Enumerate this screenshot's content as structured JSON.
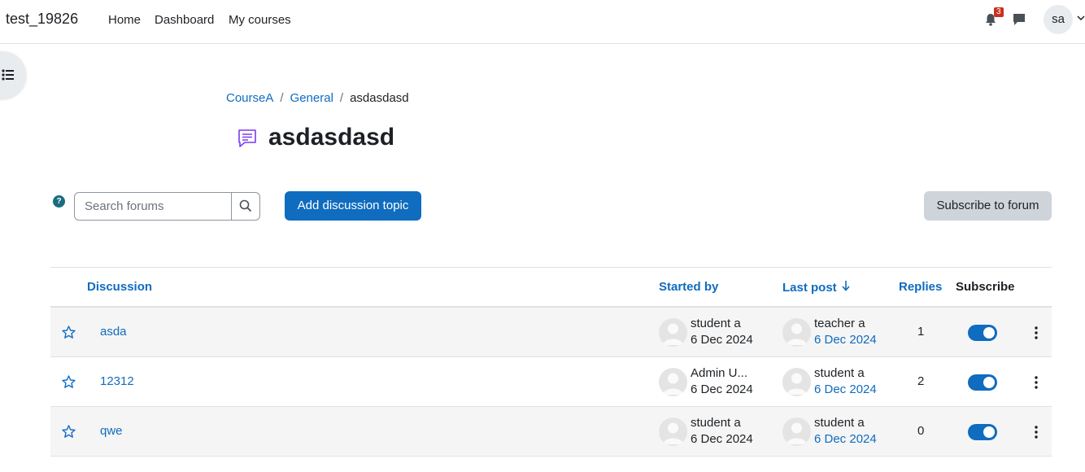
{
  "navbar": {
    "brand": "test_19826",
    "links": [
      "Home",
      "Dashboard",
      "My courses"
    ],
    "notification_count": "3",
    "user_initials": "sa"
  },
  "breadcrumb": [
    "CourseA",
    "General",
    "asdasdasd"
  ],
  "page": {
    "title": "asdasdasd"
  },
  "toolbar": {
    "help": "?",
    "search_placeholder": "Search forums",
    "search_value": "",
    "add_label": "Add discussion topic",
    "subscribe_label": "Subscribe to forum"
  },
  "table": {
    "headers": {
      "discussion": "Discussion",
      "started_by": "Started by",
      "last_post": "Last post",
      "replies": "Replies",
      "subscribe": "Subscribe"
    },
    "rows": [
      {
        "title": "asda",
        "started_by": "student a",
        "started_date": "6 Dec 2024",
        "last_post_by": "teacher a",
        "last_post_date": "6 Dec 2024",
        "replies": "1",
        "subscribed": true
      },
      {
        "title": "12312",
        "started_by": "Admin U...",
        "started_date": "6 Dec 2024",
        "last_post_by": "student a",
        "last_post_date": "6 Dec 2024",
        "replies": "2",
        "subscribed": true
      },
      {
        "title": "qwe",
        "started_by": "student a",
        "started_date": "6 Dec 2024",
        "last_post_by": "student a",
        "last_post_date": "6 Dec 2024",
        "replies": "0",
        "subscribed": true
      }
    ]
  },
  "colors": {
    "accent": "#0f6cbf",
    "forum_icon": "#7c3aed",
    "badge": "#ca3120",
    "help_icon": "#1a6c82"
  },
  "icons": [
    "drawer-index-icon",
    "bell-icon",
    "chat-icon",
    "caret-down-icon",
    "forum-icon",
    "help-icon",
    "search-icon",
    "sort-down-icon",
    "star-icon",
    "user-avatar-icon",
    "kebab-menu-icon"
  ]
}
